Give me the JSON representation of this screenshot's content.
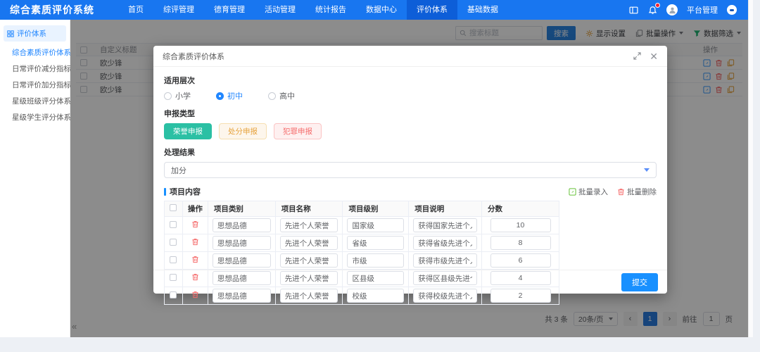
{
  "navbar": {
    "logo": "综合素质评价系统",
    "items": [
      {
        "label": "首页",
        "active": false
      },
      {
        "label": "综评管理",
        "active": false
      },
      {
        "label": "德育管理",
        "active": false
      },
      {
        "label": "活动管理",
        "active": false
      },
      {
        "label": "统计报告",
        "active": false
      },
      {
        "label": "数据中心",
        "active": false
      },
      {
        "label": "评价体系",
        "active": true
      },
      {
        "label": "基础数据",
        "active": false
      }
    ],
    "user": "平台管理"
  },
  "sidebar": {
    "group": "评价体系",
    "items": [
      {
        "label": "综合素质评价体系",
        "active": true
      },
      {
        "label": "日常评价减分指标",
        "active": false
      },
      {
        "label": "日常评价加分指标",
        "active": false
      },
      {
        "label": "星级班级评分体系",
        "active": false
      },
      {
        "label": "星级学生评分体系",
        "active": false
      }
    ],
    "collapse": "«"
  },
  "toolbar": {
    "search_placeholder": "搜索标题",
    "search_button": "搜索",
    "display_settings": "显示设置",
    "batch_actions": "批量操作",
    "data_filter": "数据筛选"
  },
  "background_table": {
    "title_column": "自定义标题",
    "op_column": "操作",
    "rows": [
      "欧少锋",
      "欧少锋",
      "欧少锋"
    ]
  },
  "pagination": {
    "total": "共 3 条",
    "page_size": "20条/页",
    "prev": "‹",
    "current": "1",
    "next": "›",
    "goto_prefix": "前往",
    "goto_value": "1",
    "goto_suffix": "页"
  },
  "modal": {
    "title": "综合素质评价体系",
    "level_label": "适用层次",
    "levels": [
      {
        "label": "小学",
        "selected": false
      },
      {
        "label": "初中",
        "selected": true
      },
      {
        "label": "高中",
        "selected": false
      }
    ],
    "type_label": "申报类型",
    "types": [
      {
        "label": "荣誉申报",
        "style": "teal"
      },
      {
        "label": "处分申报",
        "style": "orange"
      },
      {
        "label": "犯罪申报",
        "style": "red"
      }
    ],
    "result_label": "处理结果",
    "result_value": "加分",
    "content_label": "项目内容",
    "batch_import": "批量录入",
    "batch_delete": "批量删除",
    "table": {
      "headers": [
        "操作",
        "项目类别",
        "项目名称",
        "项目级别",
        "项目说明",
        "分数"
      ],
      "rows": [
        {
          "category": "思想品德",
          "name": "先进个人荣誉",
          "level": "国家级",
          "desc": "获得国家先进个人",
          "score": "10"
        },
        {
          "category": "思想品德",
          "name": "先进个人荣誉",
          "level": "省级",
          "desc": "获得省级先进个人",
          "score": "8"
        },
        {
          "category": "思想品德",
          "name": "先进个人荣誉",
          "level": "市级",
          "desc": "获得市级先进个人",
          "score": "6"
        },
        {
          "category": "思想品德",
          "name": "先进个人荣誉",
          "level": "区县级",
          "desc": "获得区县级先进个人",
          "score": "4"
        },
        {
          "category": "思想品德",
          "name": "先进个人荣誉",
          "level": "校级",
          "desc": "获得校级先进个人",
          "score": "2"
        }
      ]
    },
    "submit": "提交"
  },
  "colors": {
    "navbar": "#1876f0",
    "navbar_active": "#0d5ed8",
    "primary": "#1890ff",
    "teal_button": "#2bc0a4",
    "warning": "#e6a23c",
    "danger": "#f56c6c",
    "success": "#21b573"
  },
  "icons": {
    "grid": "sidebar group grid squares",
    "search": "magnifier",
    "gear": "settings gear (orange)",
    "copy": "two stacked sheets",
    "funnel": "filter funnel (green)",
    "panel": "layout panel",
    "bell": "notification bell with red dot",
    "user": "person avatar",
    "expand": "diagonal resize arrows",
    "close": "×",
    "edit": "pencil in square (blue)",
    "trash": "trash can (red)",
    "doc": "document copy (orange)"
  }
}
